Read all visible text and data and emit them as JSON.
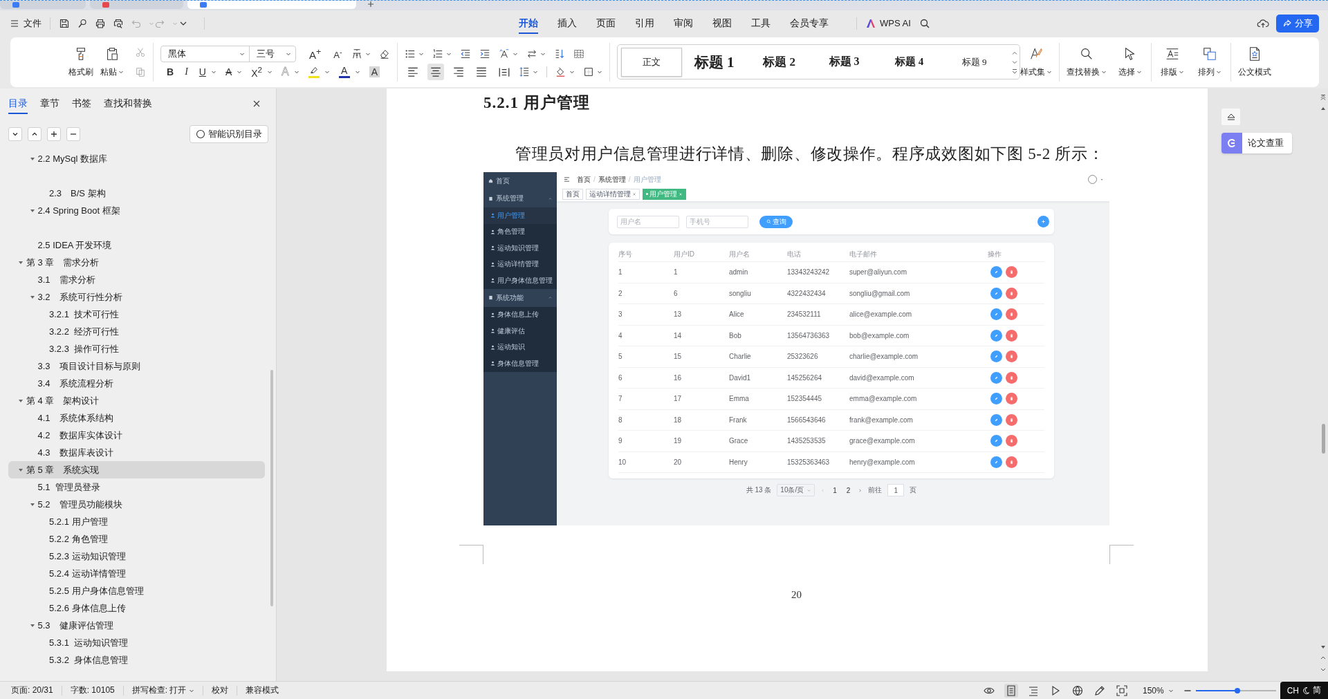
{
  "doc_tabs": [
    {
      "selected": false,
      "color": "#3b7cf5"
    },
    {
      "selected": false,
      "color": "#e5484d"
    },
    {
      "selected": true,
      "color": "#3b7cf5"
    }
  ],
  "menu_bar": {
    "file_label": "文件",
    "tabs": [
      {
        "label": "开始",
        "selected": true
      },
      {
        "label": "插入",
        "selected": false
      },
      {
        "label": "页面",
        "selected": false
      },
      {
        "label": "引用",
        "selected": false
      },
      {
        "label": "审阅",
        "selected": false
      },
      {
        "label": "视图",
        "selected": false
      },
      {
        "label": "工具",
        "selected": false
      },
      {
        "label": "会员专享",
        "selected": false
      }
    ],
    "ai_label": "WPS AI",
    "share_label": "分享"
  },
  "ribbon": {
    "clipboard": [
      {
        "kind": "format_painter",
        "label": "格式刷",
        "dropdown": false
      },
      {
        "kind": "paste",
        "label": "粘贴",
        "dropdown": true
      }
    ],
    "font_name": "黑体",
    "font_size": "三号",
    "size_keys": [
      {
        "kind": "grow",
        "glyph": "A$^{+}$"
      },
      {
        "kind": "shrink",
        "glyph": "A$^{-}$"
      }
    ],
    "format_keys": [
      {
        "kind": "bold",
        "glyph": "B",
        "dropdown": false
      },
      {
        "kind": "italic",
        "glyph": "I",
        "dropdown": false
      },
      {
        "kind": "underline",
        "glyph": "U",
        "dropdown": true
      },
      {
        "kind": "strikethrough",
        "glyph": "A",
        "dropdown": true
      },
      {
        "kind": "superscript",
        "glyph": "X$^{2}$",
        "dropdown": true
      },
      {
        "kind": "text_effect",
        "glyph": "A",
        "dropdown": true
      },
      {
        "kind": "highlight",
        "color": "#f2e21b",
        "dropdown": true
      },
      {
        "kind": "font_color",
        "glyph": "A",
        "color": "#1f33a6",
        "dropdown": true
      },
      {
        "kind": "shading",
        "glyph": "A",
        "dropdown": false
      }
    ],
    "align_buttons": [
      {
        "kind": "left",
        "selected": false
      },
      {
        "kind": "center",
        "selected": true
      },
      {
        "kind": "right",
        "selected": false
      },
      {
        "kind": "justify",
        "selected": false
      },
      {
        "kind": "distributed",
        "selected": false
      }
    ],
    "styles": [
      {
        "kind": "normal",
        "label": "正文",
        "selected": true
      },
      {
        "kind": "h1",
        "label": "标题 1",
        "selected": false
      },
      {
        "kind": "h2",
        "label": "标题 2",
        "selected": false
      },
      {
        "kind": "h3",
        "label": "标题 3",
        "selected": false
      },
      {
        "kind": "h4",
        "label": "标题 4",
        "selected": false
      },
      {
        "kind": "h9",
        "label": "标题 9",
        "selected": false
      }
    ],
    "tool_groups": [
      {
        "tools": [
          {
            "kind": "style_set",
            "label": "样式集",
            "dropdown": true
          }
        ]
      },
      {
        "tools": [
          {
            "kind": "find_replace",
            "label": "查找替换",
            "dropdown": true
          },
          {
            "kind": "select",
            "label": "选择",
            "dropdown": true
          }
        ]
      },
      {
        "tools": [
          {
            "kind": "typeset",
            "label": "排版",
            "dropdown": true
          },
          {
            "kind": "arrange",
            "label": "排列",
            "dropdown": true
          }
        ]
      },
      {
        "tools": [
          {
            "kind": "official",
            "label": "公文模式",
            "dropdown": false
          }
        ]
      }
    ]
  },
  "nav_panel": {
    "tabs": [
      {
        "label": "目录",
        "selected": true
      },
      {
        "label": "章节",
        "selected": false
      },
      {
        "label": "书签",
        "selected": false
      },
      {
        "label": "查找和替换",
        "selected": false
      }
    ],
    "smart_toc_label": "智能识别目录",
    "toc_continued": [
      {
        "title": "2.2 MySql 数据库",
        "selected": false,
        "expanded": true,
        "children": [
          {
            "kind": "blank"
          },
          {
            "title": "2.3　B/S 架构",
            "selected": false
          }
        ]
      },
      {
        "title": "2.4 Spring Boot 框架",
        "selected": false,
        "expanded": true,
        "children": [
          {
            "kind": "blank"
          }
        ]
      },
      {
        "title": "2.5 IDEA 开发环境",
        "selected": false
      }
    ],
    "toc": [
      {
        "title": "第 3 章　需求分析",
        "selected": false,
        "expanded": true,
        "children": [
          {
            "title": "3.1　需求分析",
            "selected": false
          },
          {
            "title": "3.2　系统可行性分析",
            "selected": false,
            "expanded": true,
            "children": [
              {
                "title": "3.2.1  技术可行性",
                "selected": false
              },
              {
                "title": "3.2.2  经济可行性",
                "selected": false
              },
              {
                "title": "3.2.3  操作可行性",
                "selected": false
              }
            ]
          },
          {
            "title": "3.3　项目设计目标与原则",
            "selected": false
          },
          {
            "title": "3.4　系统流程分析",
            "selected": false
          }
        ]
      },
      {
        "title": "第 4 章　架构设计",
        "selected": false,
        "expanded": true,
        "children": [
          {
            "title": "4.1　系统体系结构",
            "selected": false
          },
          {
            "title": "4.2　数据库实体设计",
            "selected": false
          },
          {
            "title": "4.3　数据库表设计",
            "selected": false
          }
        ]
      },
      {
        "title": "第 5 章　系统实现",
        "selected": true,
        "expanded": true,
        "children": [
          {
            "title": "5.1  管理员登录",
            "selected": false
          },
          {
            "title": "5.2　管理员功能模块",
            "selected": false,
            "expanded": true,
            "children": [
              {
                "title": "5.2.1 用户管理",
                "selected": false
              },
              {
                "title": "5.2.2 角色管理",
                "selected": false
              },
              {
                "title": "5.2.3 运动知识管理",
                "selected": false
              },
              {
                "title": "5.2.4 运动详情管理",
                "selected": false
              },
              {
                "title": "5.2.5 用户身体信息管理",
                "selected": false
              },
              {
                "title": "5.2.6 身体信息上传",
                "selected": false
              }
            ]
          },
          {
            "title": "5.3　健康评估管理",
            "selected": false,
            "expanded": true,
            "children": [
              {
                "title": "5.3.1  运动知识管理",
                "selected": false
              },
              {
                "title": "5.3.2  身体信息管理",
                "selected": false
              }
            ]
          }
        ]
      }
    ]
  },
  "document": {
    "heading": "5.2.1 用户管理",
    "paragraph": "管理员对用户信息管理进行详情、删除、修改操作。程序成效图如下图 5-2 所示：",
    "page_number": "20",
    "figure": {
      "sidebar": [
        {
          "kind": "item",
          "label": "首页",
          "selected": false
        },
        {
          "kind": "group",
          "label": "系统管理",
          "children": [
            {
              "label": "用户管理",
              "selected": true
            },
            {
              "label": "角色管理",
              "selected": false
            },
            {
              "label": "运动知识管理",
              "selected": false
            },
            {
              "label": "运动详情管理",
              "selected": false
            },
            {
              "label": "用户身体信息管理",
              "selected": false
            }
          ]
        },
        {
          "kind": "group",
          "label": "系统功能",
          "children": [
            {
              "label": "身体信息上传",
              "selected": false
            },
            {
              "label": "健康评估",
              "selected": false
            },
            {
              "label": "运动知识",
              "selected": false
            },
            {
              "label": "身体信息管理",
              "selected": false
            }
          ]
        }
      ],
      "breadcrumb": {
        "items": [
          "首页",
          "系统管理",
          "用户管理"
        ],
        "separator": "/"
      },
      "tags": [
        {
          "label": "首页",
          "selected": false,
          "closable": false
        },
        {
          "label": "运动详情管理",
          "selected": false,
          "closable": true
        },
        {
          "label": "用户管理",
          "selected": true,
          "closable": true
        }
      ],
      "search": {
        "fields": [
          {
            "placeholder": "用户名"
          },
          {
            "placeholder": "手机号"
          }
        ],
        "button": "查询"
      },
      "columns": [
        "序号",
        "用户ID",
        "用户名",
        "电话",
        "电子邮件",
        "操作"
      ],
      "rows": [
        {
          "cells": [
            "1",
            "1",
            "admin",
            "13343243242",
            "super@aliyun.com"
          ]
        },
        {
          "cells": [
            "2",
            "6",
            "songliu",
            "4322432434",
            "songliu@gmail.com"
          ]
        },
        {
          "cells": [
            "3",
            "13",
            "Alice",
            "234532111",
            "alice@example.com"
          ]
        },
        {
          "cells": [
            "4",
            "14",
            "Bob",
            "13564736363",
            "bob@example.com"
          ]
        },
        {
          "cells": [
            "5",
            "15",
            "Charlie",
            "25323626",
            "charlie@example.com"
          ]
        },
        {
          "cells": [
            "6",
            "16",
            "David1",
            "145256264",
            "david@example.com"
          ]
        },
        {
          "cells": [
            "7",
            "17",
            "Emma",
            "152354445",
            "emma@example.com"
          ]
        },
        {
          "cells": [
            "8",
            "18",
            "Frank",
            "1566543646",
            "frank@example.com"
          ]
        },
        {
          "cells": [
            "9",
            "19",
            "Grace",
            "1435253535",
            "grace@example.com"
          ]
        },
        {
          "cells": [
            "10",
            "20",
            "Henry",
            "15325363463",
            "henry@example.com"
          ]
        }
      ],
      "pagination": {
        "total": "共 13 条",
        "page_size": "10条/页",
        "pages": [
          "1",
          "2"
        ],
        "goto_label": "前往",
        "goto_value": "1",
        "page_unit": "页"
      }
    }
  },
  "side_tools": {
    "check_label": "论文查重"
  },
  "status_bar": {
    "items": [
      {
        "label": "页面: 20/31",
        "dropdown": false
      },
      {
        "label": "字数: 10105",
        "dropdown": false
      },
      {
        "label": "拼写检查: 打开",
        "dropdown": true
      },
      {
        "label": "校对",
        "dropdown": false
      },
      {
        "label": "兼容模式",
        "dropdown": false
      }
    ],
    "view_buttons": [
      {
        "kind": "eye",
        "selected": false
      },
      {
        "kind": "page",
        "selected": true
      },
      {
        "kind": "outline",
        "selected": false
      },
      {
        "kind": "play",
        "selected": false
      },
      {
        "kind": "web",
        "selected": false
      },
      {
        "kind": "pen",
        "selected": false
      },
      {
        "kind": "fit",
        "selected": false
      }
    ],
    "zoom": {
      "reading": "150%",
      "level": 0.52
    },
    "ime": {
      "language": "CH",
      "mode": "简"
    }
  }
}
